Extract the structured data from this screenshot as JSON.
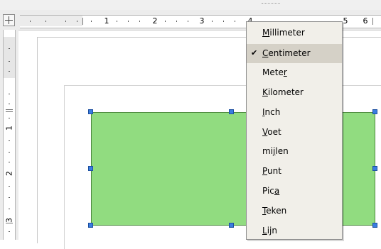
{
  "horizontal_ruler": {
    "numbers": [
      "1",
      "2",
      "3",
      "4",
      "5",
      "6"
    ]
  },
  "vertical_ruler": {
    "numbers": [
      "1",
      "2",
      "3"
    ]
  },
  "context_menu": {
    "items": [
      {
        "label": "Millimeter",
        "mnemonic": "M",
        "checked": false
      },
      {
        "label": "Centimeter",
        "mnemonic": "C",
        "checked": true
      },
      {
        "label": "Meter",
        "mnemonic": "r",
        "checked": false
      },
      {
        "label": "Kilometer",
        "mnemonic": "K",
        "checked": false
      },
      {
        "label": "Inch",
        "mnemonic": "I",
        "checked": false
      },
      {
        "label": "Voet",
        "mnemonic": "V",
        "checked": false
      },
      {
        "label": "mijlen",
        "mnemonic": "j",
        "checked": false
      },
      {
        "label": "Punt",
        "mnemonic": "P",
        "checked": false
      },
      {
        "label": "Pica",
        "mnemonic": "a",
        "checked": false
      },
      {
        "label": "Teken",
        "mnemonic": "T",
        "checked": false
      },
      {
        "label": "Lijn",
        "mnemonic": "L",
        "checked": false
      }
    ],
    "check_icon": "checkmark"
  },
  "colors": {
    "shape_fill": "#91dc80",
    "handle": "#3a7de0",
    "menu_background": "#f1efe9"
  }
}
